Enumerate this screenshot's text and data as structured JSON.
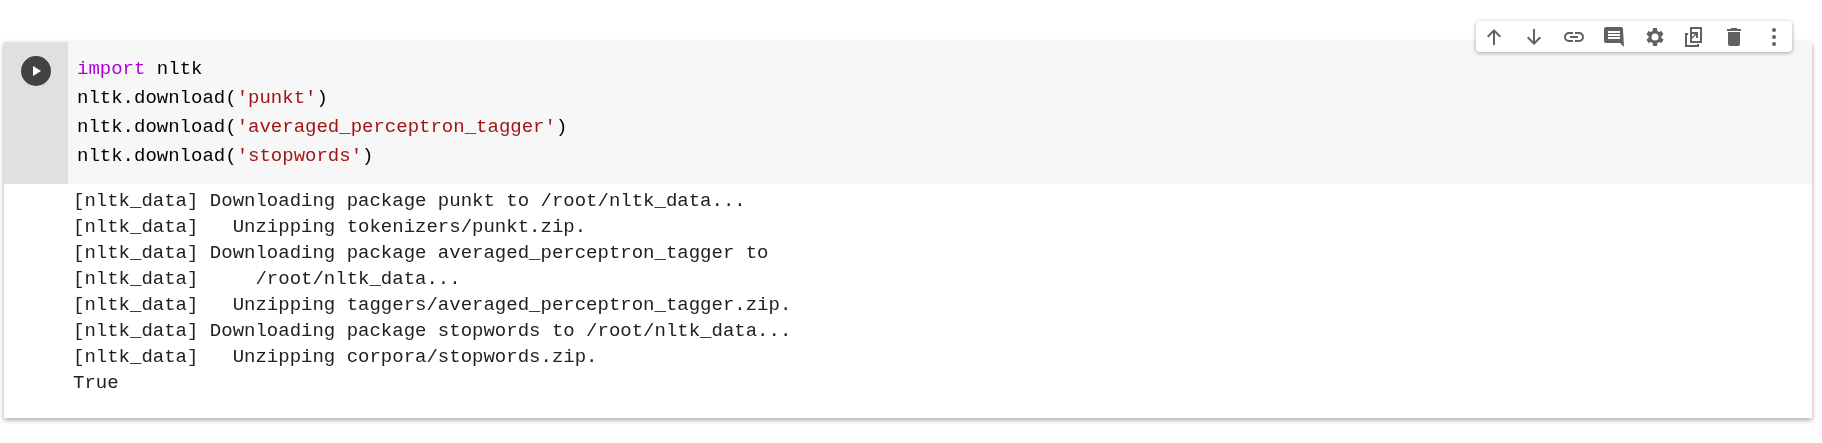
{
  "cell_toolbar": {
    "buttons": [
      {
        "kind": "up"
      },
      {
        "kind": "down"
      },
      {
        "kind": "link"
      },
      {
        "kind": "comment"
      },
      {
        "kind": "settings"
      },
      {
        "kind": "mirror"
      },
      {
        "kind": "delete"
      },
      {
        "kind": "more"
      }
    ]
  },
  "code_cell": {
    "lines": [
      {
        "tokens": [
          {
            "kind": "keyword",
            "text": "import"
          },
          {
            "kind": "plain",
            "text": " nltk"
          }
        ]
      },
      {
        "tokens": [
          {
            "kind": "plain",
            "text": "nltk.download("
          },
          {
            "kind": "string",
            "text": "'punkt'"
          },
          {
            "kind": "plain",
            "text": ")"
          }
        ]
      },
      {
        "tokens": [
          {
            "kind": "plain",
            "text": "nltk.download("
          },
          {
            "kind": "string",
            "text": "'averaged_perceptron_tagger'"
          },
          {
            "kind": "plain",
            "text": ")"
          }
        ]
      },
      {
        "tokens": [
          {
            "kind": "plain",
            "text": "nltk.download("
          },
          {
            "kind": "string",
            "text": "'stopwords'"
          },
          {
            "kind": "plain",
            "text": ")"
          }
        ]
      }
    ],
    "output": [
      "[nltk_data] Downloading package punkt to /root/nltk_data...",
      "[nltk_data]   Unzipping tokenizers/punkt.zip.",
      "[nltk_data] Downloading package averaged_perceptron_tagger to",
      "[nltk_data]     /root/nltk_data...",
      "[nltk_data]   Unzipping taggers/averaged_perceptron_tagger.zip.",
      "[nltk_data] Downloading package stopwords to /root/nltk_data...",
      "[nltk_data]   Unzipping corpora/stopwords.zip.",
      "True"
    ]
  }
}
